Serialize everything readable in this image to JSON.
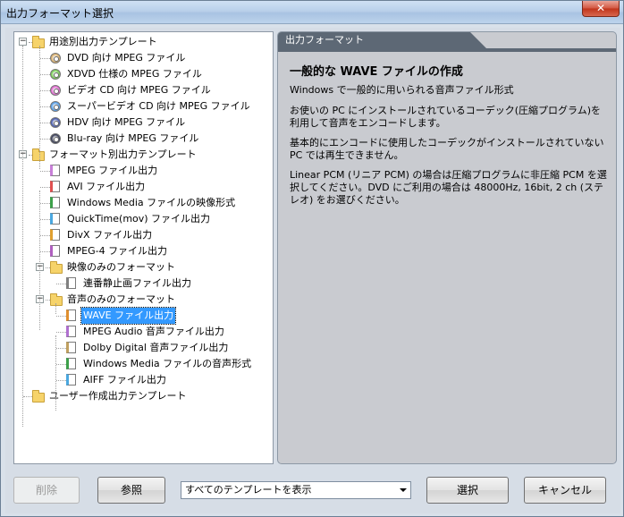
{
  "window": {
    "title": "出力フォーマット選択",
    "close_label": "✕"
  },
  "tree": {
    "items": [
      {
        "label": "用途別出力テンプレート",
        "type": "folder",
        "level": 0,
        "expander": "−"
      },
      {
        "label": "DVD 向け MPEG ファイル",
        "type": "disc",
        "level": 1,
        "color": "#d8b070"
      },
      {
        "label": "XDVD 仕様の MPEG ファイル",
        "type": "disc",
        "level": 1,
        "color": "#7ccf5a"
      },
      {
        "label": "ビデオ CD 向け MPEG ファイル",
        "type": "disc",
        "level": 1,
        "color": "#e06bd0"
      },
      {
        "label": "スーパービデオ CD 向け MPEG ファイル",
        "type": "disc",
        "level": 1,
        "color": "#5aa0e8"
      },
      {
        "label": "HDV 向け MPEG ファイル",
        "type": "disc",
        "level": 1,
        "color": "#4d5fb0"
      },
      {
        "label": "Blu-ray 向け MPEG ファイル",
        "type": "disc",
        "level": 1,
        "color": "#3a3f58"
      },
      {
        "label": "フォーマット別出力テンプレート",
        "type": "folder",
        "level": 0,
        "expander": "−"
      },
      {
        "label": "MPEG ファイル出力",
        "type": "file",
        "level": 1,
        "color": "#c87fd8"
      },
      {
        "label": "AVI ファイル出力",
        "type": "file",
        "level": 1,
        "color": "#e05050"
      },
      {
        "label": "Windows Media ファイルの映像形式",
        "type": "file",
        "level": 1,
        "color": "#3da04a"
      },
      {
        "label": "QuickTime(mov) ファイル出力",
        "type": "file",
        "level": 1,
        "color": "#4aa8e0"
      },
      {
        "label": "DivX ファイル出力",
        "type": "file",
        "level": 1,
        "color": "#e0a030"
      },
      {
        "label": "MPEG-4 ファイル出力",
        "type": "file",
        "level": 1,
        "color": "#b060c0"
      },
      {
        "label": "映像のみのフォーマット",
        "type": "folder",
        "level": 1,
        "expander": "−"
      },
      {
        "label": "連番静止画ファイル出力",
        "type": "file",
        "level": 2,
        "color": "#808080"
      },
      {
        "label": "音声のみのフォーマット",
        "type": "folder",
        "level": 1,
        "expander": "−"
      },
      {
        "label": "WAVE ファイル出力",
        "type": "file",
        "level": 2,
        "color": "#e09030",
        "selected": true
      },
      {
        "label": "MPEG Audio 音声ファイル出力",
        "type": "file",
        "level": 2,
        "color": "#b070d0"
      },
      {
        "label": "Dolby Digital 音声ファイル出力",
        "type": "file",
        "level": 2,
        "color": "#c0a060"
      },
      {
        "label": "Windows Media ファイルの音声形式",
        "type": "file",
        "level": 2,
        "color": "#3da04a"
      },
      {
        "label": "AIFF ファイル出力",
        "type": "file",
        "level": 2,
        "color": "#4aa8e0"
      },
      {
        "label": "ユーザー作成出力テンプレート",
        "type": "folder",
        "level": 0
      }
    ]
  },
  "info": {
    "header": "出力フォーマット",
    "title": "一般的な WAVE ファイルの作成",
    "paragraphs": [
      "Windows で一般的に用いられる音声ファイル形式",
      "お使いの PC にインストールされているコーデック(圧縮プログラム)を利用して音声をエンコードします。",
      "基本的にエンコードに使用したコーデックがインストールされていない PC では再生できません。",
      "Linear PCM (リニア PCM) の場合は圧縮プログラムに非圧縮 PCM を選択してください。DVD にご利用の場合は 48000Hz, 16bit, 2 ch (ステレオ) をお選びください。"
    ]
  },
  "bottom": {
    "delete_label": "削除",
    "browse_label": "参照",
    "filter_value": "すべてのテンプレートを表示",
    "select_label": "選択",
    "cancel_label": "キャンセル"
  }
}
